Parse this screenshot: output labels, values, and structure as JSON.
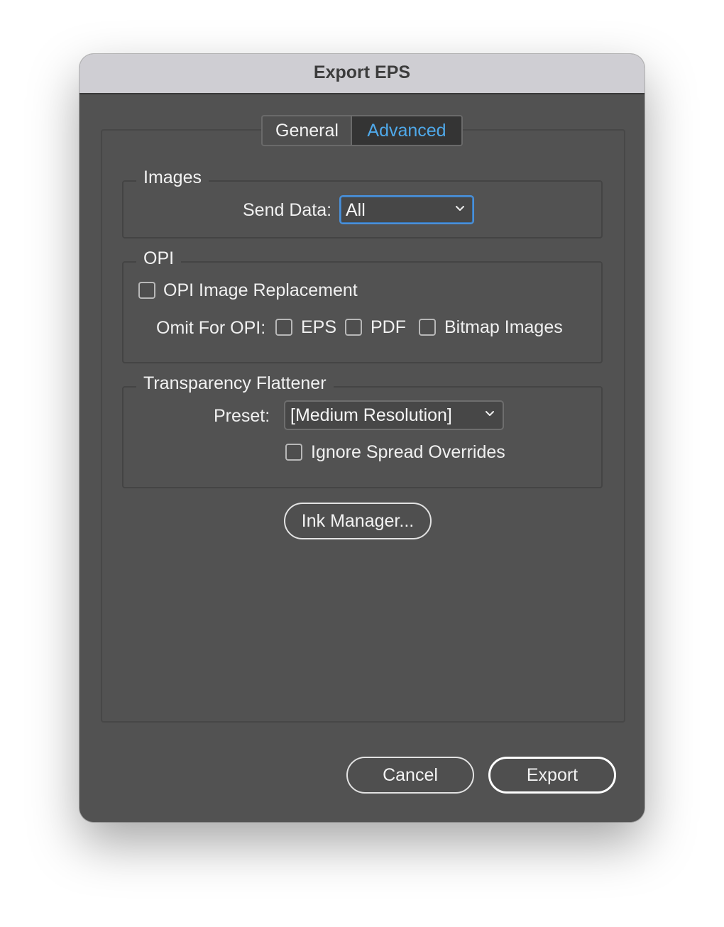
{
  "window": {
    "title": "Export EPS"
  },
  "tabs": [
    {
      "label": "General",
      "selected": false
    },
    {
      "label": "Advanced",
      "selected": true
    }
  ],
  "images": {
    "group_label": "Images",
    "send_data_label": "Send Data:",
    "send_data_value": "All"
  },
  "opi": {
    "group_label": "OPI",
    "replacement_label": "OPI Image Replacement",
    "replacement_checked": false,
    "omit_label": "Omit For OPI:",
    "omit_eps_label": "EPS",
    "omit_pdf_label": "PDF",
    "omit_bitmap_label": "Bitmap Images"
  },
  "flattener": {
    "group_label": "Transparency Flattener",
    "preset_label": "Preset:",
    "preset_value": "[Medium Resolution]",
    "ignore_overrides_label": "Ignore Spread Overrides"
  },
  "ink_manager_label": "Ink Manager...",
  "footer": {
    "cancel_label": "Cancel",
    "export_label": "Export"
  },
  "colors": {
    "accent": "#4fa9ea",
    "focus_ring": "#4a90d9",
    "dialog_bg": "#525252",
    "titlebar_bg": "#cfced3"
  }
}
